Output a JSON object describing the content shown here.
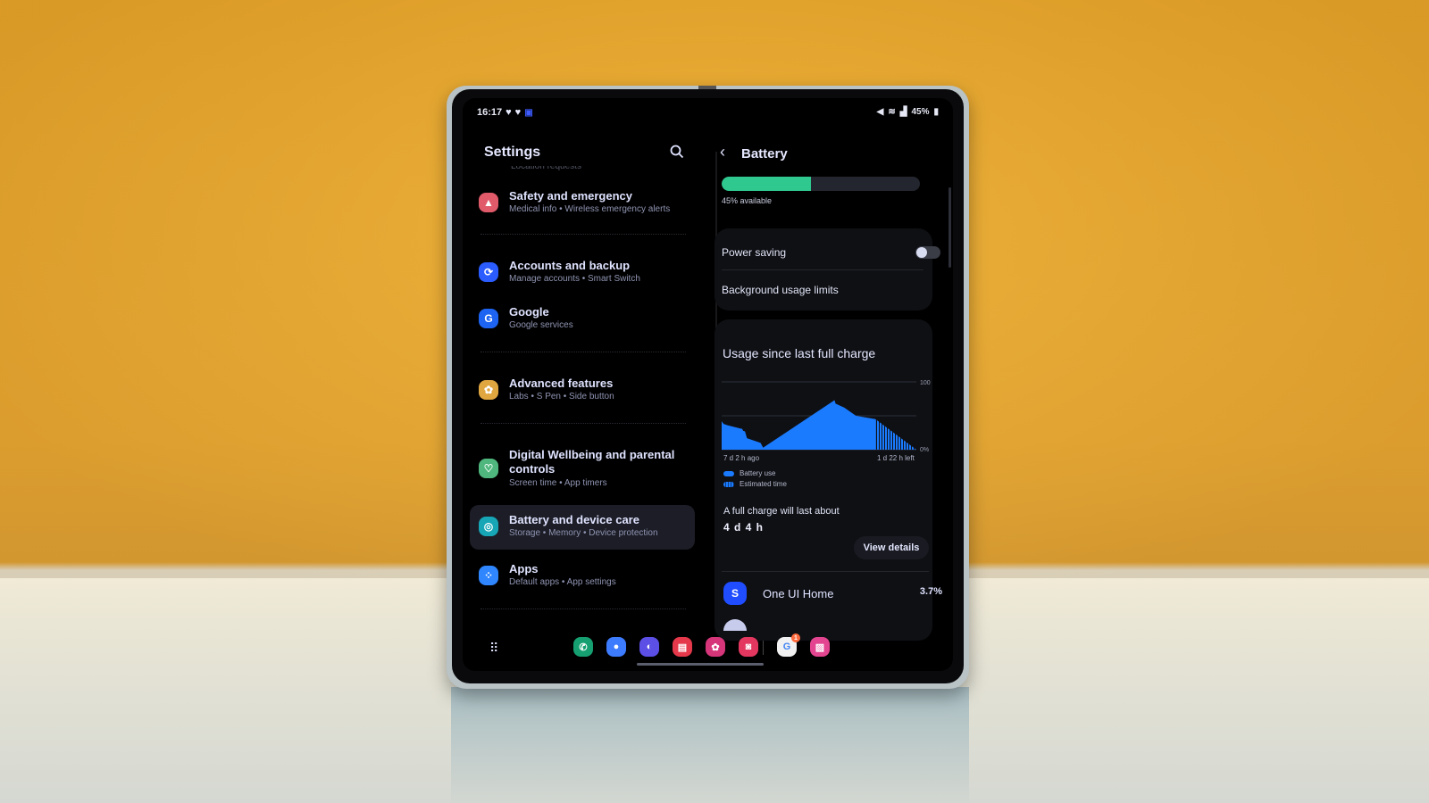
{
  "status_bar": {
    "time": "16:17",
    "left_icons": [
      "heart-icon",
      "heart-icon",
      "cast-icon"
    ],
    "right_icons": [
      "mute-icon",
      "wifi-icon",
      "signal-icon"
    ],
    "battery_percent": "45%"
  },
  "settings": {
    "title": "Settings",
    "search_icon": "search-icon",
    "cut_off_item": "Location requests",
    "items": [
      {
        "title": "Safety and emergency",
        "subtitle": "Medical info  •  Wireless emergency alerts",
        "icon": "siren-icon",
        "color": "#e05a6a"
      },
      {
        "title": "Accounts and backup",
        "subtitle": "Manage accounts  •  Smart Switch",
        "icon": "sync-icon",
        "color": "#2a5cff"
      },
      {
        "title": "Google",
        "subtitle": "Google services",
        "icon": "google-icon",
        "color": "#1d64f2"
      },
      {
        "title": "Advanced features",
        "subtitle": "Labs  •  S Pen  •  Side button",
        "icon": "gear-flower-icon",
        "color": "#e0a640"
      },
      {
        "title": "Digital Wellbeing and parental controls",
        "subtitle": "Screen time  •  App timers",
        "icon": "wellbeing-icon",
        "color": "#4fb77d"
      },
      {
        "title": "Battery and device care",
        "subtitle": "Storage  •  Memory  •  Device protection",
        "icon": "device-care-icon",
        "color": "#16a6b6",
        "selected": true
      },
      {
        "title": "Apps",
        "subtitle": "Default apps  •  App settings",
        "icon": "apps-icon",
        "color": "#2f86ff"
      }
    ]
  },
  "battery": {
    "title": "Battery",
    "back_icon": "chevron-left-icon",
    "level_percent": 45,
    "available_text": "45% available",
    "fill_color": "#2fc88f",
    "power_saving_label": "Power saving",
    "power_saving_on": false,
    "background_limits_label": "Background usage limits",
    "usage_title": "Usage since last full charge",
    "legend": [
      {
        "label": "Battery use",
        "style": "solid"
      },
      {
        "label": "Estimated time",
        "style": "hatched"
      }
    ],
    "full_charge_label": "A full charge will last about",
    "full_charge_value": "4 d 4 h",
    "view_details_label": "View details",
    "top_app": {
      "name": "One UI Home",
      "percent": "3.7%",
      "icon": "one-ui-home-icon"
    }
  },
  "chart_data": {
    "type": "area",
    "title": "Usage since last full charge",
    "xlabel": "",
    "ylabel": "",
    "x_tick_labels": [
      "7 d 2 h ago",
      "1 d 22 h left"
    ],
    "y_tick_labels": [
      "100",
      "0%"
    ],
    "ylim": [
      0,
      100
    ],
    "xlim": [
      0,
      1
    ],
    "grid": true,
    "color": "#1a7bff",
    "series": [
      {
        "name": "Battery use",
        "style": "solid",
        "x": [
          0,
          0.01,
          0.03,
          0.1,
          0.105,
          0.11,
          0.12,
          0.13,
          0.2,
          0.213,
          0.58,
          0.585,
          0.63,
          0.69,
          0.79
        ],
        "y": [
          42,
          38,
          36,
          31,
          31,
          28,
          27,
          17,
          10,
          3,
          73,
          68,
          62,
          50,
          45
        ]
      },
      {
        "name": "Estimated time",
        "style": "hatched",
        "x": [
          0.79,
          1.0
        ],
        "y": [
          45,
          0
        ]
      }
    ],
    "legend_position": "bottom-left"
  },
  "taskbar": {
    "apps_drawer_icon": "apps-grid-icon",
    "dock": [
      {
        "name": "Phone",
        "icon": "phone-icon",
        "color": "#16a071"
      },
      {
        "name": "Messages",
        "icon": "messages-icon",
        "color": "#3d7bff"
      },
      {
        "name": "Internet",
        "icon": "internet-icon",
        "color": "#5b4fe6"
      },
      {
        "name": "Samsung Notes",
        "icon": "notes-icon",
        "color": "#e5384a"
      },
      {
        "name": "Galaxy Store",
        "icon": "flower-icon",
        "color": "#d6357a"
      },
      {
        "name": "Camera",
        "icon": "camera-icon",
        "color": "#e43760"
      },
      {
        "name": "Google",
        "icon": "google-app-icon",
        "color": "#f1f1f1",
        "badge": "1"
      },
      {
        "name": "Gallery",
        "icon": "gallery-icon",
        "color": "#e44590"
      }
    ]
  }
}
